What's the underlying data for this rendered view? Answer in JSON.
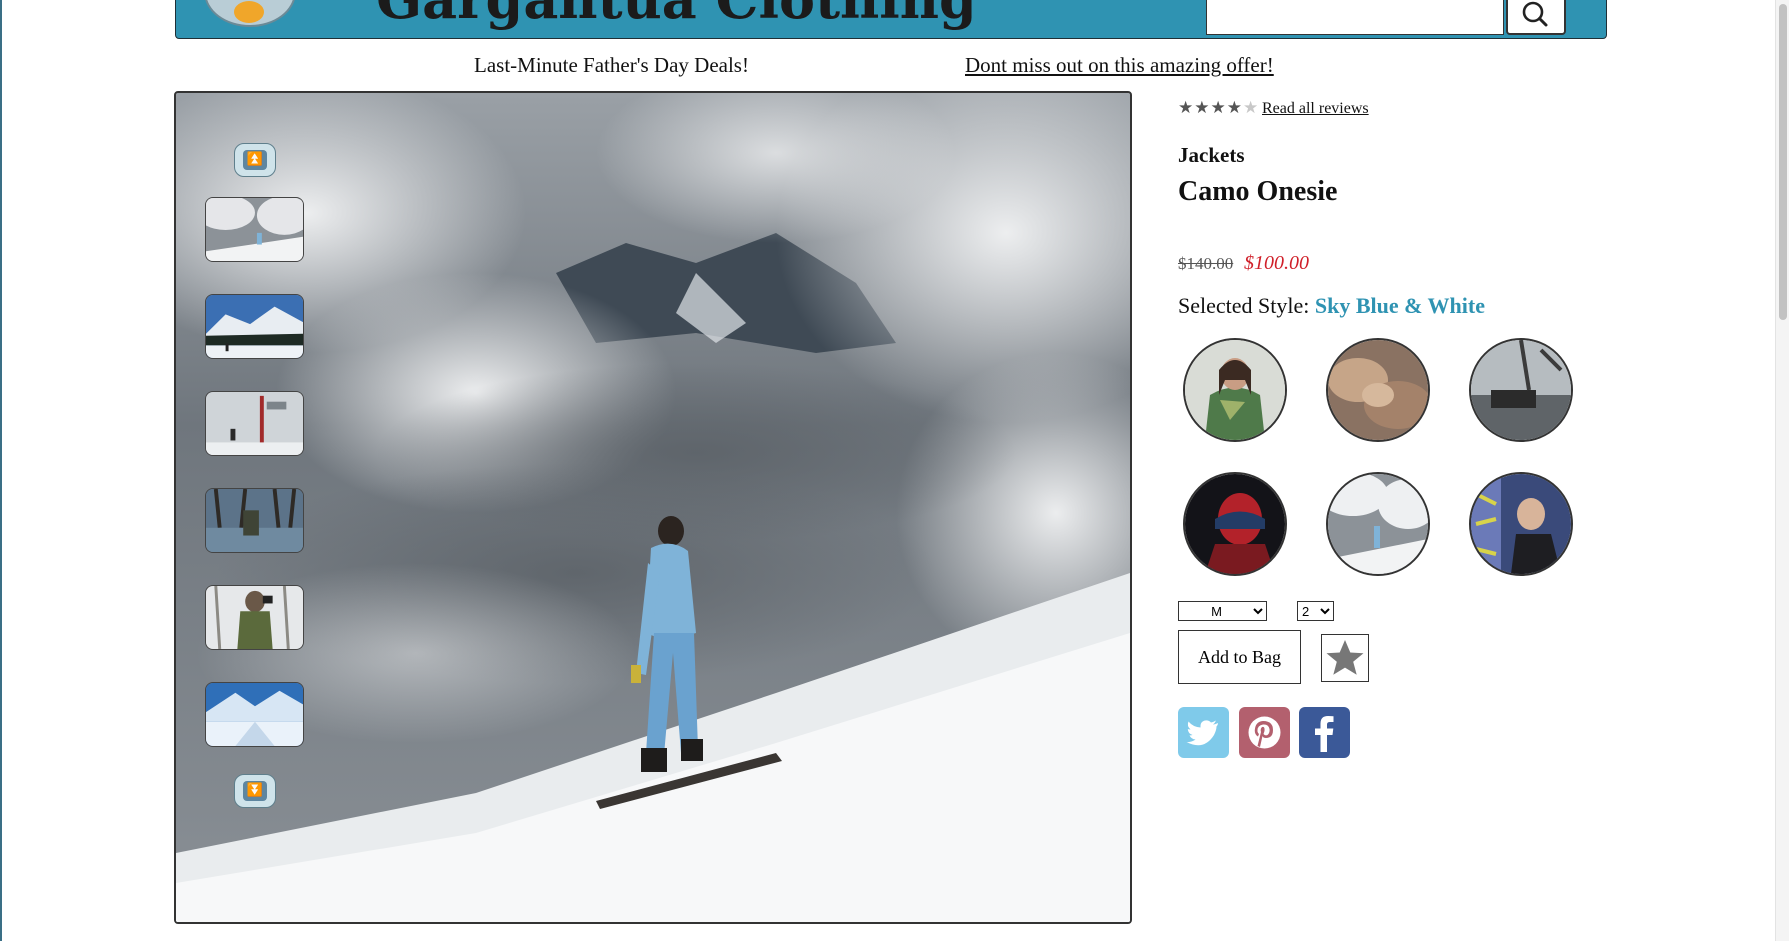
{
  "header": {
    "brand": "Gargantua Clothing",
    "search": {
      "value": "",
      "placeholder": ""
    },
    "search_icon": "search-icon",
    "logo_icon": "logo-icon"
  },
  "promos": {
    "left": "Last-Minute Father's Day Deals!",
    "right": "Dont miss out on this amazing offer!"
  },
  "gallery": {
    "up_arrow_icon": "double-chevron-up-icon",
    "down_arrow_icon": "double-chevron-down-icon",
    "thumbnails": [
      "snowboarder-clouds",
      "mountain-skier",
      "snowy-street",
      "tree-photographer",
      "camo-photographer",
      "glacier-valley"
    ],
    "selected_thumbnail": 0
  },
  "product": {
    "rating": 4,
    "rating_max": 5,
    "reviews_link": "Read all reviews",
    "category": "Jackets",
    "name": "Camo Onesie",
    "original_price": "$140.00",
    "sale_price": "$100.00",
    "selected_style_label": "Selected Style:",
    "selected_style_name": "Sky Blue & White",
    "styles": [
      "green-camo",
      "desert-camo",
      "urban-grey",
      "red-black",
      "sky-blue-white",
      "graffiti"
    ],
    "size": "M",
    "quantity": "2",
    "add_to_bag": "Add to Bag",
    "favorite_icon": "star-icon"
  },
  "social": [
    {
      "name": "twitter",
      "color": "#7fcaea"
    },
    {
      "name": "pinterest",
      "color": "#b3606e"
    },
    {
      "name": "facebook",
      "color": "#3b5998"
    }
  ],
  "colors": {
    "header_bg": "#2f93b2",
    "style_accent": "#2f93b2",
    "sale_red": "#d0202a"
  }
}
